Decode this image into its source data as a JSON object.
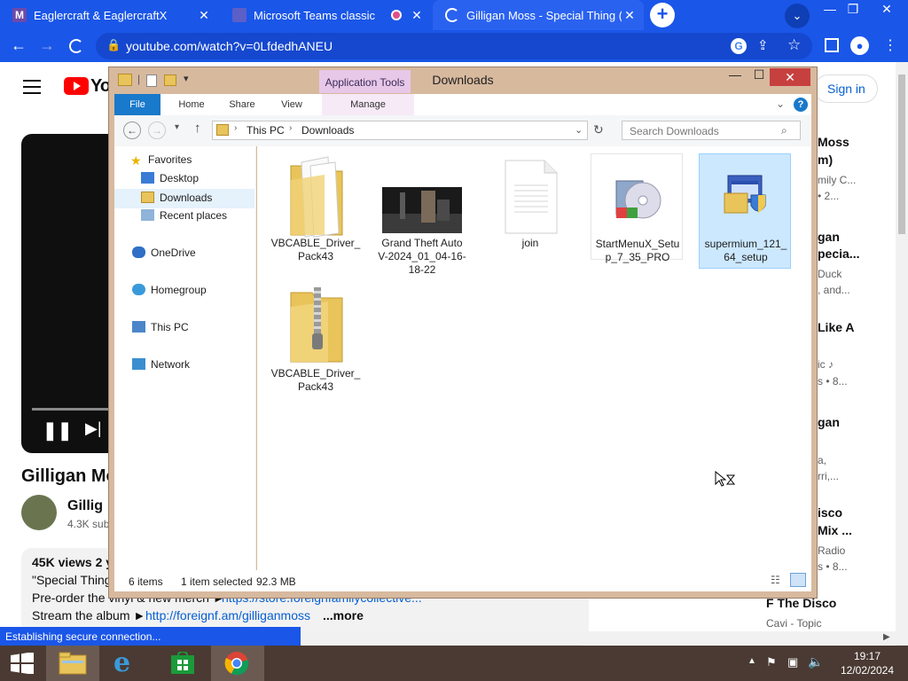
{
  "browser": {
    "tabs": [
      {
        "title": "Eaglercraft & EaglercraftX",
        "favicon_color": "#6d4aa8"
      },
      {
        "title": "Microsoft Teams classic",
        "favicon_color": "#5b5fc7"
      },
      {
        "title": "Gilligan Moss - Special Thing (Of",
        "favicon_color": "#ffffff"
      }
    ],
    "new_tab_symbol": "+",
    "url": "youtube.com/watch?v=0LfdedhANEU",
    "status_text": "Establishing secure connection..."
  },
  "youtube": {
    "logo_text": "Yo",
    "sign_in": "Sign in",
    "video_title": "Gilligan Mo",
    "channel_name": "Gillig",
    "subscribers": "4.3K sub",
    "views_line": "45K views  2 y",
    "desc_lines": [
      "\"Special Thing",
      "Pre-order the vinyl & new merch ►",
      "Stream the album ►"
    ],
    "desc_links": [
      "https://store.foreignfamilycollective...",
      "http://foreignf.am/gilliganmoss"
    ],
    "more": "...more",
    "sidebar": [
      {
        "title": "Moss",
        "sub": "m)",
        "meta1": "mily C...",
        "meta2": "• 2..."
      },
      {
        "title": "gan",
        "sub": "pecia...",
        "meta1": "Duck",
        "meta2": ", and..."
      },
      {
        "title": "Like A",
        "sub": "",
        "meta1": "ic ♪",
        "meta2": "s • 8..."
      },
      {
        "title": "gan",
        "sub": "",
        "meta1": "a,",
        "meta2": "rri,..."
      },
      {
        "title": "isco",
        "sub": "Mix ...",
        "meta1": "Radio",
        "meta2": "s • 8..."
      },
      {
        "title": "F The Disco",
        "sub": "",
        "meta1": "Cavi - Topic",
        "meta2": ""
      }
    ]
  },
  "explorer": {
    "title": "Downloads",
    "app_tools": "Application Tools",
    "ribbon_tabs": [
      "File",
      "Home",
      "Share",
      "View",
      "Manage"
    ],
    "breadcrumb": [
      "This PC",
      "Downloads"
    ],
    "search_placeholder": "Search Downloads",
    "nav": {
      "favorites": "Favorites",
      "desktop": "Desktop",
      "downloads": "Downloads",
      "recent": "Recent places",
      "onedrive": "OneDrive",
      "homegroup": "Homegroup",
      "thispc": "This PC",
      "network": "Network"
    },
    "files": [
      {
        "name": "VBCABLE_Driver_ Pack43",
        "kind": "folder"
      },
      {
        "name": "Grand Theft Auto V-2024_01_04-16- 18-22",
        "kind": "video"
      },
      {
        "name": "join",
        "kind": "document"
      },
      {
        "name": "StartMenuX_Setu p_7_35_PRO",
        "kind": "installer"
      },
      {
        "name": "supermium_121_ 64_setup",
        "kind": "setup"
      },
      {
        "name": "VBCABLE_Driver_ Pack43",
        "kind": "zip"
      }
    ],
    "status": {
      "items": "6 items",
      "selected": "1 item selected",
      "size": "92.3 MB"
    }
  },
  "taskbar": {
    "time": "19:17",
    "date": "12/02/2024"
  }
}
